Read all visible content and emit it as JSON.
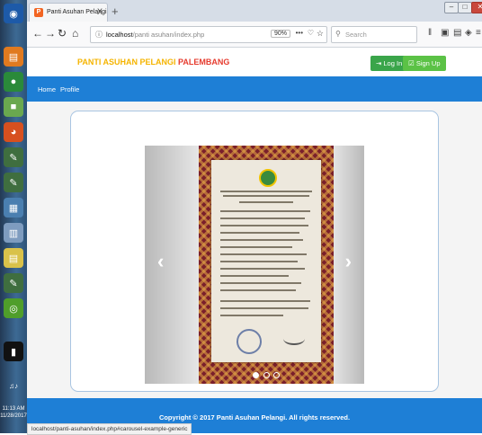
{
  "taskbar": {
    "clock_time": "11:13 AM",
    "clock_date": "11/28/2017"
  },
  "browser": {
    "tab_title": "Panti Asuhan Pelangi",
    "tab_close": "X",
    "new_tab": "+",
    "url_host": "localhost",
    "url_path": "/panti asuhan/index.php",
    "zoom": "90%",
    "more": "•••",
    "search_placeholder": "Search",
    "status_url": "localhost/panti-asuhan/index.php#carousel-example-generic"
  },
  "site": {
    "brand_part1": "PANTI ASUHAN PELANGI",
    "brand_part2": "PALEMBANG",
    "login_label": "Log In",
    "signup_label": "Sign Up",
    "menu": [
      {
        "label": "Home"
      },
      {
        "label": "Profile"
      }
    ],
    "footer_text": "Copyright © 2017 Panti Asuhan Pelangi. All rights reserved."
  },
  "carousel": {
    "prev_glyph": "‹",
    "next_glyph": "›",
    "slide_count": 3,
    "active_index": 0
  }
}
